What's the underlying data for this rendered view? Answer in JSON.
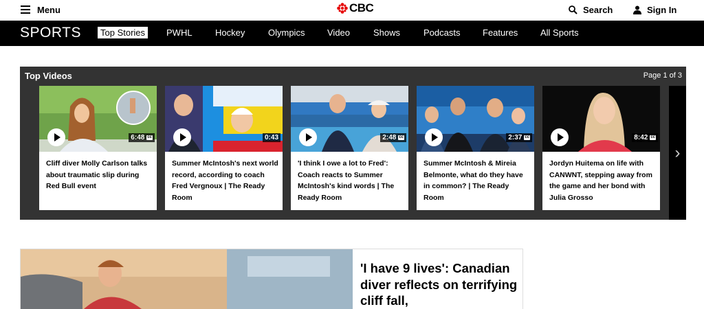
{
  "header": {
    "menu_label": "Menu",
    "logo_text": "CBC",
    "search_label": "Search",
    "signin_label": "Sign In"
  },
  "nav": {
    "section_title": "SPORTS",
    "items": [
      {
        "label": "Top Stories",
        "active": true
      },
      {
        "label": "PWHL"
      },
      {
        "label": "Hockey"
      },
      {
        "label": "Olympics"
      },
      {
        "label": "Video"
      },
      {
        "label": "Shows"
      },
      {
        "label": "Podcasts"
      },
      {
        "label": "Features"
      },
      {
        "label": "All Sports"
      }
    ]
  },
  "top_videos": {
    "title": "Top Videos",
    "page_indicator": "Page 1 of 3",
    "cards": [
      {
        "duration": "6:48",
        "cc": "cc",
        "title": "Cliff diver Molly Carlson talks about traumatic slip during Red Bull event"
      },
      {
        "duration": "0:43",
        "title": "Summer McIntosh's next world record, according to coach Fred Vergnoux | The Ready Room"
      },
      {
        "duration": "2:48",
        "cc": "cc",
        "title": "'I think I owe a lot to Fred': Coach reacts to Summer McIntosh's kind words | The Ready Room"
      },
      {
        "duration": "2:37",
        "cc": "cc",
        "title": "Summer McIntosh & Mireia Belmonte, what do they have in common? | The Ready Room"
      },
      {
        "duration": "8:42",
        "cc": "cc",
        "title": "Jordyn Huitema on life with CANWNT, stepping away from the game and her bond with Julia Grosso"
      }
    ],
    "next_icon": "›"
  },
  "feature": {
    "headline": "'I have 9 lives': Canadian diver reflects on terrifying cliff fall,"
  },
  "colors": {
    "cbc_red": "#e60505",
    "nav_bg": "#000000",
    "panel_bg": "#333333"
  }
}
